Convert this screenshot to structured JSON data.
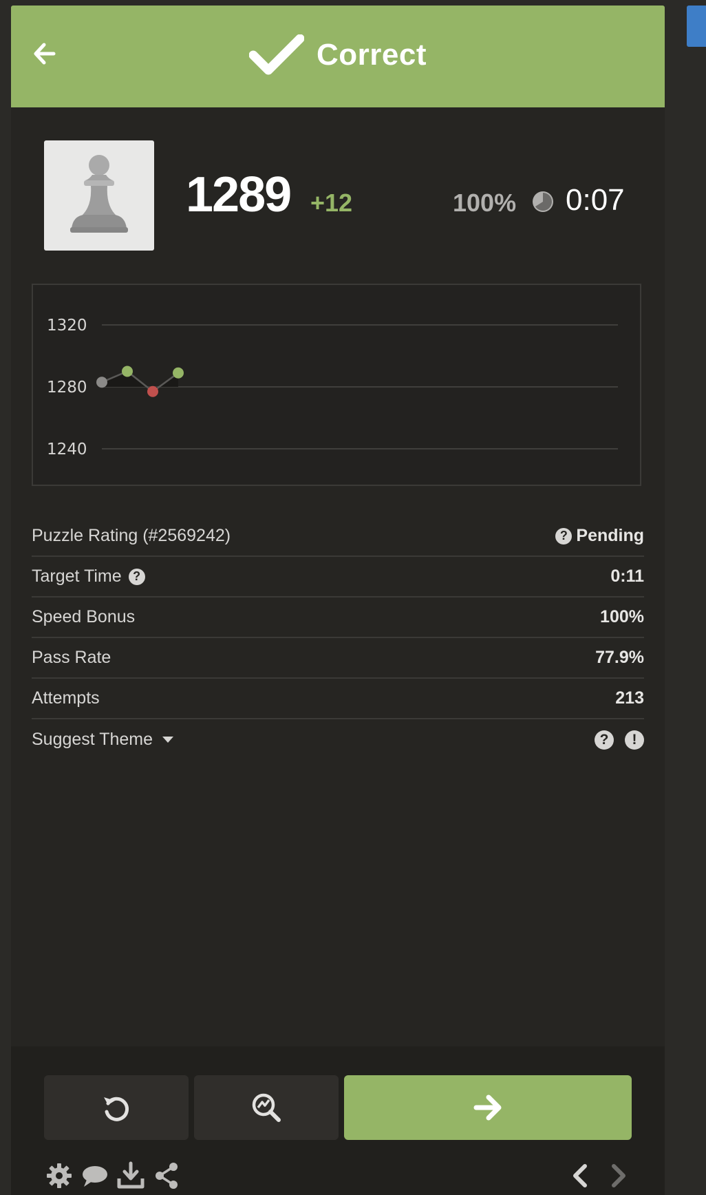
{
  "header": {
    "title": "Correct",
    "back_icon": "arrow-left-icon",
    "status_icon": "checkmark-icon",
    "color": "#95b566"
  },
  "summary": {
    "rating": "1289",
    "delta": "+12",
    "speed_percent": "100%",
    "time": "0:07",
    "piece_icon": "pawn-icon",
    "clock_icon": "clock-icon"
  },
  "chart_data": {
    "type": "line",
    "y_ticks": [
      "1320",
      "1280",
      "1240"
    ],
    "ylim": [
      1240,
      1320
    ],
    "grid": true,
    "points": [
      {
        "x": 1,
        "y": 1283,
        "result": "neutral",
        "color": "#8b8a88"
      },
      {
        "x": 2,
        "y": 1290,
        "result": "correct",
        "color": "#95b566"
      },
      {
        "x": 3,
        "y": 1277,
        "result": "incorrect",
        "color": "#c0504d"
      },
      {
        "x": 4,
        "y": 1289,
        "result": "correct",
        "color": "#95b566"
      }
    ]
  },
  "stats": [
    {
      "label": "Puzzle Rating (#2569242)",
      "value": "Pending"
    },
    {
      "label": "Target Time",
      "value": "0:11"
    },
    {
      "label": "Speed Bonus",
      "value": "100%"
    },
    {
      "label": "Pass Rate",
      "value": "77.9%"
    },
    {
      "label": "Attempts",
      "value": "213"
    },
    {
      "label": "Suggest Theme",
      "value": ""
    }
  ],
  "footer": {
    "buttons": [
      "retry-icon",
      "analysis-icon",
      "arrow-right-icon"
    ],
    "tools": [
      "gear-icon",
      "chat-icon",
      "download-icon",
      "share-icon",
      "chevron-left-icon",
      "chevron-right-icon"
    ],
    "accent": "#95b566"
  }
}
